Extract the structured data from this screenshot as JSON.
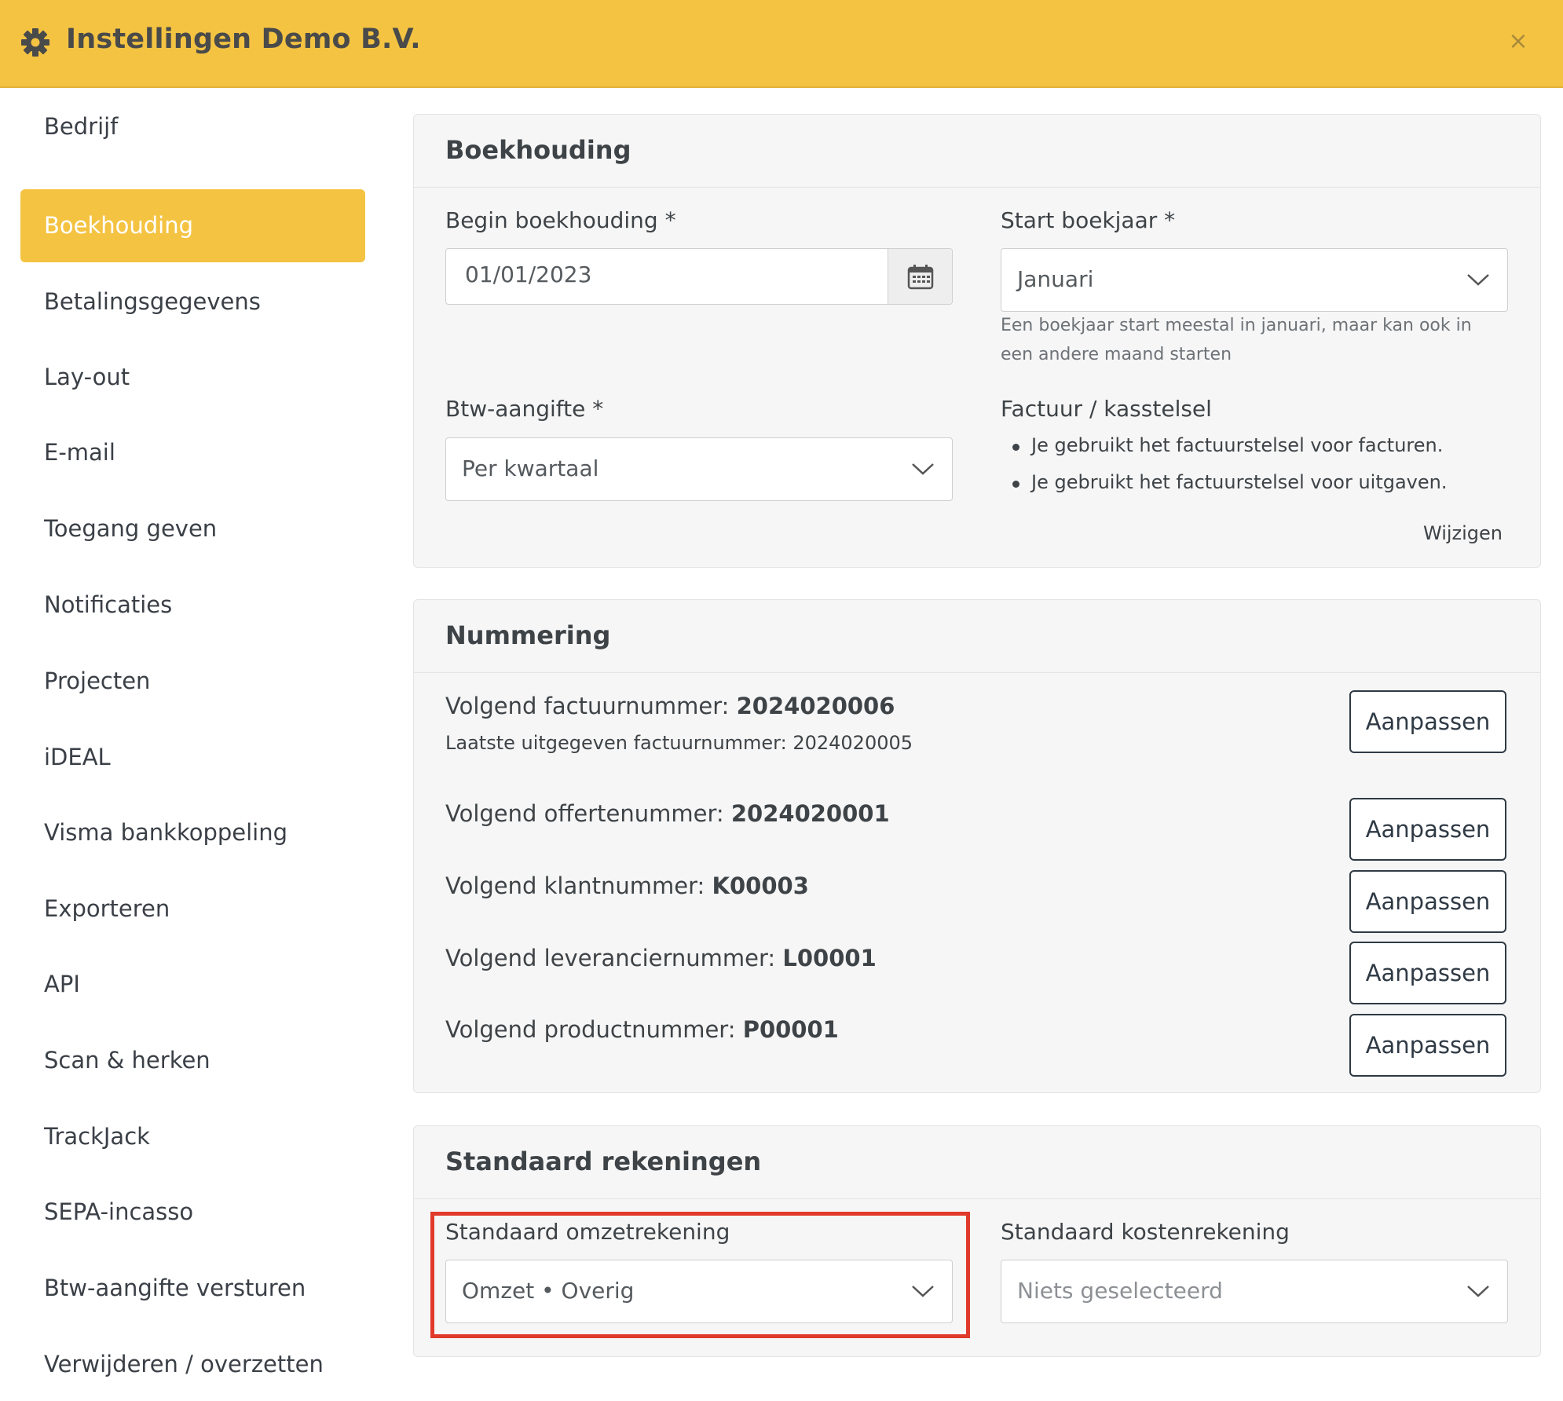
{
  "header": {
    "title": "Instellingen Demo B.V.",
    "gear_icon": "gear-icon",
    "close_symbol": "×",
    "bg_color": "#f4c342"
  },
  "sidebar": {
    "items": [
      {
        "label": "Bedrijf",
        "active": false
      },
      {
        "label": "Boekhouding",
        "active": true
      },
      {
        "label": "Betalingsgegevens",
        "active": false
      },
      {
        "label": "Lay-out",
        "active": false
      },
      {
        "label": "E-mail",
        "active": false
      },
      {
        "label": "Toegang geven",
        "active": false
      },
      {
        "label": "Notificaties",
        "active": false
      },
      {
        "label": "Projecten",
        "active": false
      },
      {
        "label": "iDEAL",
        "active": false
      },
      {
        "label": "Visma bankkoppeling",
        "active": false
      },
      {
        "label": "Exporteren",
        "active": false
      },
      {
        "label": "API",
        "active": false
      },
      {
        "label": "Scan & herken",
        "active": false
      },
      {
        "label": "TrackJack",
        "active": false
      },
      {
        "label": "SEPA-incasso",
        "active": false
      },
      {
        "label": "Btw-aangifte versturen",
        "active": false
      },
      {
        "label": "Verwijderen / overzetten",
        "active": false
      }
    ]
  },
  "boekhouding": {
    "title": "Boekhouding",
    "begin_label": "Begin boekhouding *",
    "begin_value": "01/01/2023",
    "start_label": "Start boekjaar *",
    "start_value": "Januari",
    "start_help_line1": "Een boekjaar start meestal in januari, maar kan ook in",
    "start_help_line2": "een andere maand starten",
    "btw_label": "Btw-aangifte *",
    "btw_value": "Per kwartaal",
    "factuur_label": "Factuur / kasstelsel",
    "factuur_bullets": [
      "Je gebruikt het factuurstelsel voor facturen.",
      "Je gebruikt het factuurstelsel voor uitgaven."
    ],
    "wijzigen_label": "Wijzigen"
  },
  "nummering": {
    "title": "Nummering",
    "rows": [
      {
        "label": "Volgend factuurnummer: ",
        "value": "2024020006",
        "button": "Aanpassen"
      },
      {
        "label": "Volgend offertenummer: ",
        "value": "2024020001",
        "button": "Aanpassen"
      },
      {
        "label": "Volgend klantnummer: ",
        "value": "K00003",
        "button": "Aanpassen"
      },
      {
        "label": "Volgend leveranciernummer: ",
        "value": "L00001",
        "button": "Aanpassen"
      },
      {
        "label": "Volgend productnummer: ",
        "value": "P00001",
        "button": "Aanpassen"
      }
    ],
    "last_invoice_note": "Laatste uitgegeven factuurnummer: 2024020005"
  },
  "rekeningen": {
    "title": "Standaard rekeningen",
    "omzet_label": "Standaard omzetrekening",
    "omzet_value": "Omzet • Overig",
    "kosten_label": "Standaard kostenrekening",
    "kosten_value": "Niets geselecteerd"
  },
  "colors": {
    "accent": "#f4c342",
    "highlight_border": "#e03a2b",
    "button_border": "#2f3a45"
  }
}
